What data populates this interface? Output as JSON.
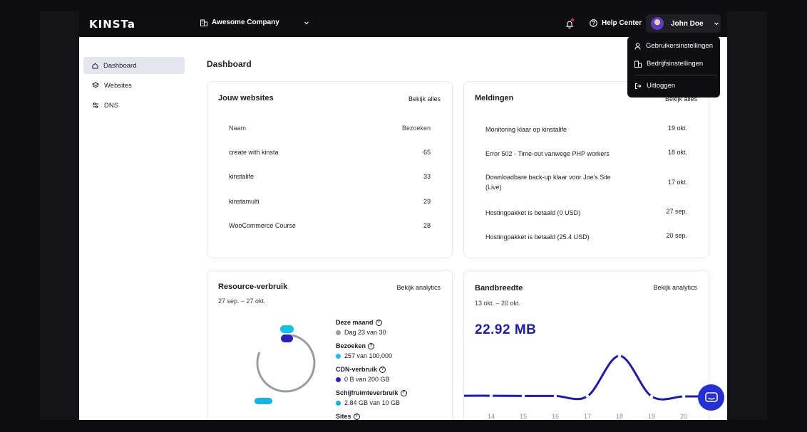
{
  "topbar": {
    "logo": "KINSTa",
    "company": "Awesome Company",
    "help_label": "Help Center",
    "user_name": "John Doe"
  },
  "sidebar": {
    "items": [
      {
        "label": "Dashboard",
        "icon": "home-icon",
        "active": true
      },
      {
        "label": "Websites",
        "icon": "layers-icon",
        "active": false
      },
      {
        "label": "DNS",
        "icon": "dns-icon",
        "active": false
      }
    ]
  },
  "page": {
    "title": "Dashboard"
  },
  "websites": {
    "title": "Jouw websites",
    "link": "Bekijk alles",
    "col_name": "Naam",
    "col_visits": "Bezoeken",
    "rows": [
      {
        "name": "create with kinsta",
        "visits": "65"
      },
      {
        "name": "kinstalife",
        "visits": "33"
      },
      {
        "name": "kinstamulti",
        "visits": "29"
      },
      {
        "name": "WooCommerce Course",
        "visits": "28"
      }
    ]
  },
  "notifications": {
    "title": "Meldingen",
    "link": "Bekijk alles",
    "rows": [
      {
        "msg": "Monitoring klaar op kinstalife",
        "date": "19 okt."
      },
      {
        "msg": "Error 502 - Time-out vanwege PHP workers",
        "date": "18 okt."
      },
      {
        "msg": "Downloadbare back-up klaar voor Joe's Site (Live)",
        "date": "17 okt."
      },
      {
        "msg": "Hostingpakket is betaald (0 USD)",
        "date": "27 sep."
      },
      {
        "msg": "Hostingpakket is betaald (25.4 USD)",
        "date": "20 sep."
      }
    ]
  },
  "resources": {
    "title": "Resource-verbruik",
    "link": "Bekijk analytics",
    "range": "27 sep. – 27 okt.",
    "legend": [
      {
        "label": "Deze maand",
        "value": "Dag 23 van 30",
        "color": "#9a9ca5"
      },
      {
        "label": "Bezoeken",
        "value": "257 van 100,000",
        "color": "#12c2e9"
      },
      {
        "label": "CDN-verbruik",
        "value": "0 B van 200 GB",
        "color": "#2a1fc4"
      },
      {
        "label": "Schijfruimteverbruik",
        "value": "2.84 GB van 10 GB",
        "color": "#12b3e6"
      },
      {
        "label": "Sites",
        "value": "",
        "color": "#12c2e9"
      }
    ],
    "month_progress": 0.767
  },
  "bandwidth": {
    "title": "Bandbreedte",
    "link": "Bekijk analytics",
    "range": "13 okt. – 20 okt.",
    "total": "22.92 MB"
  },
  "chart_data": {
    "type": "line",
    "title": "Bandbreedte",
    "x": [
      "14",
      "15",
      "16",
      "17",
      "18",
      "19",
      "20"
    ],
    "series": [
      {
        "values": [
          0.3,
          0.2,
          0.2,
          0.1,
          18.4,
          0.0,
          0.0
        ],
        "color": "#1b1bb5"
      }
    ],
    "ylim": [
      0,
      20
    ],
    "grid": false
  },
  "user_menu": {
    "items": [
      {
        "label": "Gebruikersinstellingen",
        "icon": "user-icon"
      },
      {
        "label": "Bedrijfsinstellingen",
        "icon": "building-icon"
      },
      {
        "label": "Uitloggen",
        "icon": "logout-icon"
      }
    ]
  }
}
